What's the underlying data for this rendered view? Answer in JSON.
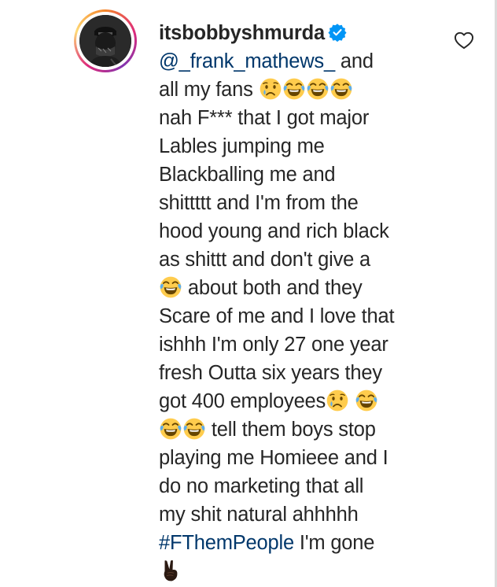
{
  "comment": {
    "username": "itsbobbyshmurda",
    "mention": "@_frank_mathews_",
    "hashtag": "#FThemPeople",
    "lines": [
      " and",
      "all my fans",
      "nah F*** that I got major",
      "Lables jumping me",
      "Blackballing me and",
      "shittttt and I'm from the",
      "hood young and rich black",
      "as shittt and don't give a",
      " about both and they",
      "Scare of me and I love that",
      "ishhh I'm only 27 one year",
      "fresh Outta six years they",
      "got 400 employees",
      " tell them boys stop",
      "playing me Homieee and I",
      "do no marketing that all",
      "my shit natural ahhhhh",
      " I'm gone"
    ]
  },
  "icons": {
    "verified": "verified-badge-icon",
    "like": "heart-outline-icon",
    "emoji_cry": "crying-face-emoji",
    "emoji_laugh": "tears-of-joy-emoji",
    "emoji_peace": "victory-hand-emoji"
  },
  "colors": {
    "text": "#262626",
    "link": "#00376b",
    "verified": "#0095f6"
  }
}
